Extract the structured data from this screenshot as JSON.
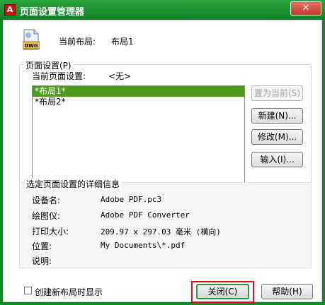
{
  "window": {
    "title": "页面设置管理器",
    "close_label": "✕"
  },
  "current_layout": {
    "label": "当前布局:",
    "value": "布局1"
  },
  "page_setups": {
    "legend": "页面设置(P)",
    "current_label": "当前页面设置:",
    "current_value": "<无>",
    "items": [
      "*布局1*",
      "*布局2*"
    ],
    "selected_index": 0
  },
  "buttons": {
    "set_current": "置为当前(S)",
    "new": "新建(N)...",
    "modify": "修改(M)...",
    "import": "输入(I)...",
    "close": "关闭(C)",
    "help": "帮助(H)"
  },
  "details": {
    "title": "选定页面设置的详细信息",
    "rows": [
      {
        "label": "设备名:",
        "value": "Adobe PDF.pc3"
      },
      {
        "label": "绘图仪:",
        "value": "Adobe PDF Converter"
      },
      {
        "label": "打印大小:",
        "value": "209.97 x 297.03 毫米 (横向)"
      },
      {
        "label": "位置:",
        "value": "My Documents\\*.pdf"
      },
      {
        "label": "说明:",
        "value": ""
      }
    ]
  },
  "options": {
    "show_on_new_layout_label": "创建新布局时显示",
    "show_on_new_layout_checked": false
  },
  "icons": {
    "app": "autocad-icon",
    "file": "dwg-file-icon"
  },
  "colors": {
    "titlebar": "#1a9630",
    "selection": "#4e9a1e",
    "highlight": "#e01020"
  }
}
